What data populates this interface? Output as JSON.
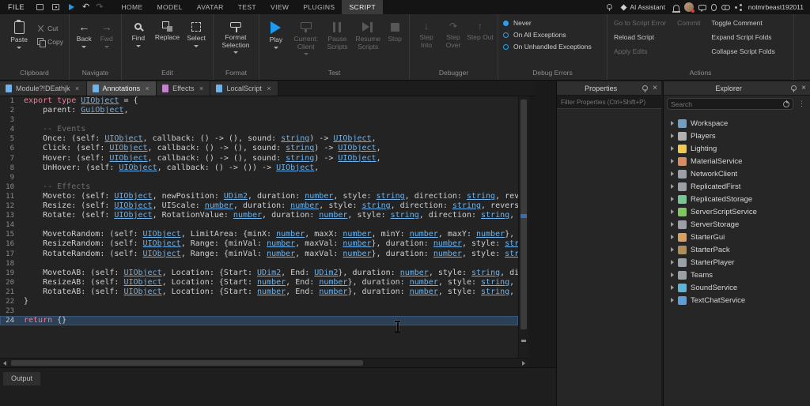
{
  "titlebar": {
    "file": "FILE",
    "menu_tabs": [
      {
        "label": "HOME",
        "active": false
      },
      {
        "label": "MODEL",
        "active": false
      },
      {
        "label": "AVATAR",
        "active": false
      },
      {
        "label": "TEST",
        "active": false
      },
      {
        "label": "VIEW",
        "active": false
      },
      {
        "label": "PLUGINS",
        "active": false
      },
      {
        "label": "SCRIPT",
        "active": true
      }
    ],
    "ai_assistant": "AI Assistant",
    "username": "notmrbeast192011"
  },
  "ribbon": {
    "clipboard": {
      "label": "Clipboard",
      "paste": "Paste",
      "cut": "Cut",
      "copy": "Copy"
    },
    "navigate": {
      "label": "Navigate",
      "back": "Back",
      "fwd": "Fwd"
    },
    "edit": {
      "label": "Edit",
      "find": "Find",
      "replace": "Replace",
      "select": "Select"
    },
    "format": {
      "label": "Format",
      "format_selection": "Format Selection"
    },
    "test": {
      "label": "Test",
      "play": "Play",
      "current_client": "Current: Client",
      "pause_scripts": "Pause Scripts",
      "resume_scripts": "Resume Scripts",
      "stop": "Stop"
    },
    "debugger": {
      "label": "Debugger",
      "step_into": "Step Into",
      "step_over": "Step Over",
      "step_out": "Step Out"
    },
    "debug_errors": {
      "label": "Debug Errors",
      "options": [
        {
          "label": "Never",
          "selected": true
        },
        {
          "label": "On All Exceptions",
          "selected": false
        },
        {
          "label": "On Unhandled Exceptions",
          "selected": false
        }
      ]
    },
    "actions": {
      "label": "Actions",
      "items": [
        {
          "label": "Go to Script Error",
          "enabled": false,
          "col": 1
        },
        {
          "label": "Reload Script",
          "enabled": true,
          "col": 1
        },
        {
          "label": "Apply Edits",
          "enabled": false,
          "col": 1
        },
        {
          "label": "Commit",
          "enabled": false,
          "col": 2
        },
        {
          "label": "Toggle Comment",
          "enabled": true,
          "col": 3
        },
        {
          "label": "Expand Script Folds",
          "enabled": true,
          "col": 3
        },
        {
          "label": "Collapse Script Folds",
          "enabled": true,
          "col": 3
        }
      ]
    }
  },
  "editor_tabs": [
    {
      "label": "Module?!DEathjk",
      "active": false,
      "icon_color": "#6fb1e8"
    },
    {
      "label": "Annotations",
      "active": true,
      "icon_color": "#6fb1e8"
    },
    {
      "label": "Effects",
      "active": false,
      "icon_color": "#c77fd4"
    },
    {
      "label": "LocalScript",
      "active": false,
      "icon_color": "#6fb1e8"
    }
  ],
  "code": {
    "language": "luau",
    "current_line": 24,
    "lines": [
      {
        "n": 1,
        "t": [
          [
            "k",
            "export type "
          ],
          [
            "ty",
            "UIObject"
          ],
          [
            "p",
            " = {"
          ]
        ]
      },
      {
        "n": 2,
        "t": [
          [
            "p",
            "    parent: "
          ],
          [
            "ty",
            "GuiObject"
          ],
          [
            "p",
            ","
          ]
        ]
      },
      {
        "n": 3,
        "t": []
      },
      {
        "n": 4,
        "t": [
          [
            "c",
            "    -- Events"
          ]
        ]
      },
      {
        "n": 5,
        "t": [
          [
            "p",
            "    Once: (self: "
          ],
          [
            "ty",
            "UIObject"
          ],
          [
            "p",
            ", callback: () -> (), sound: "
          ],
          [
            "ty",
            "string"
          ],
          [
            "p",
            ") -> "
          ],
          [
            "ty",
            "UIObject"
          ],
          [
            "p",
            ","
          ]
        ]
      },
      {
        "n": 6,
        "t": [
          [
            "p",
            "    Click: (self: "
          ],
          [
            "ty",
            "UIObject"
          ],
          [
            "p",
            ", callback: () -> (), sound: "
          ],
          [
            "ty",
            "string"
          ],
          [
            "p",
            ") -> "
          ],
          [
            "ty",
            "UIObject"
          ],
          [
            "p",
            ","
          ]
        ]
      },
      {
        "n": 7,
        "t": [
          [
            "p",
            "    Hover: (self: "
          ],
          [
            "ty",
            "UIObject"
          ],
          [
            "p",
            ", callback: () -> (), sound: "
          ],
          [
            "ty",
            "string"
          ],
          [
            "p",
            ") -> "
          ],
          [
            "ty",
            "UIObject"
          ],
          [
            "p",
            ","
          ]
        ]
      },
      {
        "n": 8,
        "t": [
          [
            "p",
            "    UnHover: (self: "
          ],
          [
            "ty",
            "UIObject"
          ],
          [
            "p",
            ", callback: () -> ()) -> "
          ],
          [
            "ty",
            "UIObject"
          ],
          [
            "p",
            ","
          ]
        ]
      },
      {
        "n": 9,
        "t": []
      },
      {
        "n": 10,
        "t": [
          [
            "c",
            "    -- Effects"
          ]
        ]
      },
      {
        "n": 11,
        "t": [
          [
            "p",
            "    Moveto: (self: "
          ],
          [
            "ty",
            "UIObject"
          ],
          [
            "p",
            ", newPosition: "
          ],
          [
            "ty",
            "UDim2"
          ],
          [
            "p",
            ", duration: "
          ],
          [
            "ty",
            "number"
          ],
          [
            "p",
            ", style: "
          ],
          [
            "ty",
            "string"
          ],
          [
            "p",
            ", direction: "
          ],
          [
            "ty",
            "string"
          ],
          [
            "p",
            ", rever"
          ]
        ]
      },
      {
        "n": 12,
        "t": [
          [
            "p",
            "    Resize: (self: "
          ],
          [
            "ty",
            "UIObject"
          ],
          [
            "p",
            ", UIScale: "
          ],
          [
            "ty",
            "number"
          ],
          [
            "p",
            ", duration: "
          ],
          [
            "ty",
            "number"
          ],
          [
            "p",
            ", style: "
          ],
          [
            "ty",
            "string"
          ],
          [
            "p",
            ", direction: "
          ],
          [
            "ty",
            "string"
          ],
          [
            "p",
            ", reverse:"
          ]
        ]
      },
      {
        "n": 13,
        "t": [
          [
            "p",
            "    Rotate: (self: "
          ],
          [
            "ty",
            "UIObject"
          ],
          [
            "p",
            ", RotationValue: "
          ],
          [
            "ty",
            "number"
          ],
          [
            "p",
            ", duration: "
          ],
          [
            "ty",
            "number"
          ],
          [
            "p",
            ", style: "
          ],
          [
            "ty",
            "string"
          ],
          [
            "p",
            ", direction: "
          ],
          [
            "ty",
            "string"
          ],
          [
            "p",
            ", re"
          ]
        ]
      },
      {
        "n": 14,
        "t": []
      },
      {
        "n": 15,
        "t": [
          [
            "p",
            "    MovetoRandom: (self: "
          ],
          [
            "ty",
            "UIObject"
          ],
          [
            "p",
            ", LimitArea: {minX: "
          ],
          [
            "ty",
            "number"
          ],
          [
            "p",
            ", maxX: "
          ],
          [
            "ty",
            "number"
          ],
          [
            "p",
            ", minY: "
          ],
          [
            "ty",
            "number"
          ],
          [
            "p",
            ", maxY: "
          ],
          [
            "ty",
            "number"
          ],
          [
            "p",
            "}, du"
          ]
        ]
      },
      {
        "n": 16,
        "t": [
          [
            "p",
            "    ResizeRandom: (self: "
          ],
          [
            "ty",
            "UIObject"
          ],
          [
            "p",
            ", Range: {minVal: "
          ],
          [
            "ty",
            "number"
          ],
          [
            "p",
            ", maxVal: "
          ],
          [
            "ty",
            "number"
          ],
          [
            "p",
            "}, duration: "
          ],
          [
            "ty",
            "number"
          ],
          [
            "p",
            ", style: "
          ],
          [
            "ty",
            "strin"
          ]
        ]
      },
      {
        "n": 17,
        "t": [
          [
            "p",
            "    RotateRandom: (self: "
          ],
          [
            "ty",
            "UIObject"
          ],
          [
            "p",
            ", Range: {minVal: "
          ],
          [
            "ty",
            "number"
          ],
          [
            "p",
            ", maxVal: "
          ],
          [
            "ty",
            "number"
          ],
          [
            "p",
            "}, duration: "
          ],
          [
            "ty",
            "number"
          ],
          [
            "p",
            ", style: "
          ],
          [
            "ty",
            "strin"
          ]
        ]
      },
      {
        "n": 18,
        "t": []
      },
      {
        "n": 19,
        "t": [
          [
            "p",
            "    MovetoAB: (self: "
          ],
          [
            "ty",
            "UIObject"
          ],
          [
            "p",
            ", Location: {Start: "
          ],
          [
            "ty",
            "UDim2"
          ],
          [
            "p",
            ", End: "
          ],
          [
            "ty",
            "UDim2"
          ],
          [
            "p",
            "}, duration: "
          ],
          [
            "ty",
            "number"
          ],
          [
            "p",
            ", style: "
          ],
          [
            "ty",
            "string"
          ],
          [
            "p",
            ", dire"
          ]
        ]
      },
      {
        "n": 20,
        "t": [
          [
            "p",
            "    ResizeAB: (self: "
          ],
          [
            "ty",
            "UIObject"
          ],
          [
            "p",
            ", Location: {Start: "
          ],
          [
            "ty",
            "number"
          ],
          [
            "p",
            ", End: "
          ],
          [
            "ty",
            "number"
          ],
          [
            "p",
            "}, duration: "
          ],
          [
            "ty",
            "number"
          ],
          [
            "p",
            ", style: "
          ],
          [
            "ty",
            "string"
          ],
          [
            "p",
            ", di"
          ]
        ]
      },
      {
        "n": 21,
        "t": [
          [
            "p",
            "    RotateAB: (self: "
          ],
          [
            "ty",
            "UIObject"
          ],
          [
            "p",
            ", Location: {Start: "
          ],
          [
            "ty",
            "number"
          ],
          [
            "p",
            ", End: "
          ],
          [
            "ty",
            "number"
          ],
          [
            "p",
            "}, duration: "
          ],
          [
            "ty",
            "number"
          ],
          [
            "p",
            ", style: "
          ],
          [
            "ty",
            "string"
          ],
          [
            "p",
            ", di"
          ]
        ]
      },
      {
        "n": 22,
        "t": [
          [
            "p",
            "}"
          ]
        ]
      },
      {
        "n": 23,
        "t": []
      },
      {
        "n": 24,
        "t": [
          [
            "k",
            "return"
          ],
          [
            "p",
            " {}"
          ]
        ]
      }
    ]
  },
  "properties_panel": {
    "title": "Properties",
    "filter_placeholder": "Filter Properties (Ctrl+Shift+P)"
  },
  "explorer": {
    "title": "Explorer",
    "search_placeholder": "Search",
    "items": [
      {
        "label": "Workspace",
        "icon": "workspace-icon",
        "color": "#6f9fc8"
      },
      {
        "label": "Players",
        "icon": "players-icon",
        "color": "#b0b0b0"
      },
      {
        "label": "Lighting",
        "icon": "lighting-icon",
        "color": "#f2c94c"
      },
      {
        "label": "MaterialService",
        "icon": "material-service-icon",
        "color": "#d98c5f"
      },
      {
        "label": "NetworkClient",
        "icon": "network-client-icon",
        "color": "#9aa0a6"
      },
      {
        "label": "ReplicatedFirst",
        "icon": "replicated-first-icon",
        "color": "#9aa0a6"
      },
      {
        "label": "ReplicatedStorage",
        "icon": "replicated-storage-icon",
        "color": "#76c893"
      },
      {
        "label": "ServerScriptService",
        "icon": "server-script-service-icon",
        "color": "#7ec95c"
      },
      {
        "label": "ServerStorage",
        "icon": "server-storage-icon",
        "color": "#9aa0a6"
      },
      {
        "label": "StarterGui",
        "icon": "starter-gui-icon",
        "color": "#d9a05f"
      },
      {
        "label": "StarterPack",
        "icon": "starter-pack-icon",
        "color": "#b08d57"
      },
      {
        "label": "StarterPlayer",
        "icon": "starter-player-icon",
        "color": "#9aa0a6"
      },
      {
        "label": "Teams",
        "icon": "teams-icon",
        "color": "#9aa0a6"
      },
      {
        "label": "SoundService",
        "icon": "sound-service-icon",
        "color": "#5fb3d9"
      },
      {
        "label": "TextChatService",
        "icon": "text-chat-service-icon",
        "color": "#5f9dd9"
      }
    ]
  },
  "output": {
    "label": "Output"
  }
}
